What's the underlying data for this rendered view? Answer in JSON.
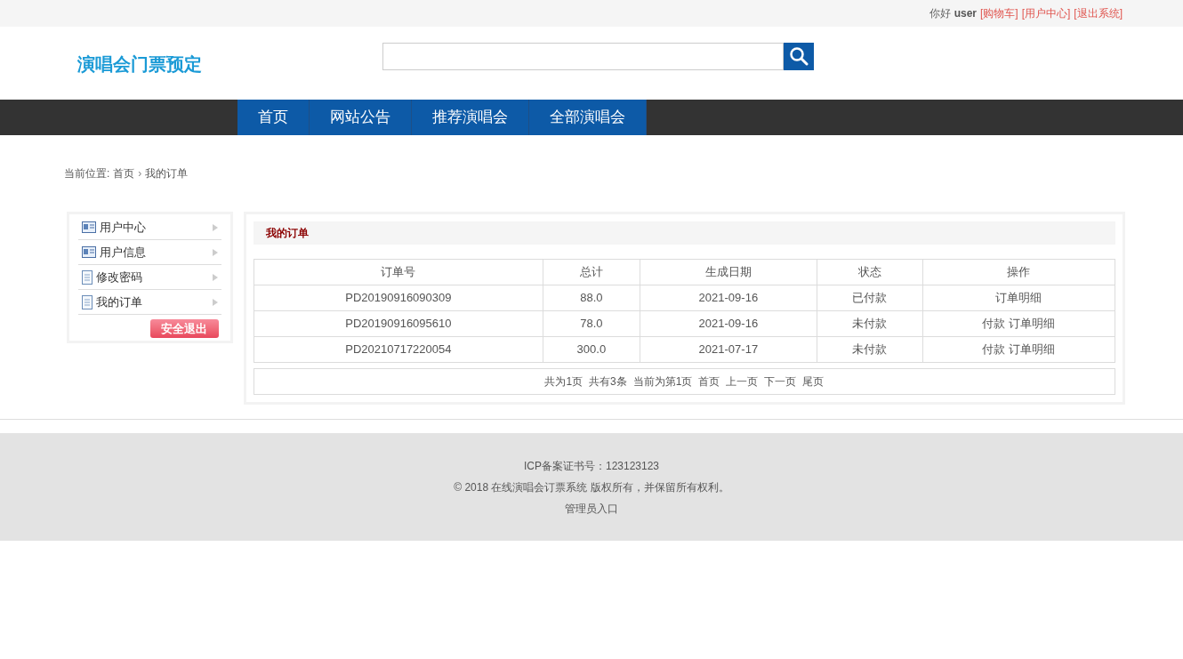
{
  "top_bar": {
    "greeting": "你好",
    "username": "user",
    "links": [
      "[购物车]",
      "[用户中心]",
      "[退出系统]"
    ]
  },
  "logo": "演唱会门票预定",
  "nav": [
    "首页",
    "网站公告",
    "推荐演唱会",
    "全部演唱会"
  ],
  "breadcrumb": {
    "label": "当前位置:",
    "items": [
      "首页",
      "我的订单"
    ],
    "separator": "›"
  },
  "sidebar": {
    "items": [
      {
        "label": "用户中心",
        "kind": "card"
      },
      {
        "label": "用户信息",
        "kind": "card"
      },
      {
        "label": "修改密码",
        "kind": "doc"
      },
      {
        "label": "我的订单",
        "kind": "doc"
      }
    ],
    "logout": "安全退出"
  },
  "orders": {
    "title": "我的订单",
    "columns": [
      "订单号",
      "总计",
      "生成日期",
      "状态",
      "操作"
    ],
    "rows": [
      {
        "id": "PD20190916090309",
        "total": "88.0",
        "date": "2021-09-16",
        "status": "已付款",
        "actions": [
          "订单明细"
        ]
      },
      {
        "id": "PD20190916095610",
        "total": "78.0",
        "date": "2021-09-16",
        "status": "未付款",
        "actions": [
          "付款",
          "订单明细"
        ]
      },
      {
        "id": "PD20210717220054",
        "total": "300.0",
        "date": "2021-07-17",
        "status": "未付款",
        "actions": [
          "付款",
          "订单明细"
        ]
      }
    ],
    "pagination": {
      "info": [
        "共为1页",
        "共有3条",
        "当前为第1页"
      ],
      "links": [
        "首页",
        "上一页",
        "下一页",
        "尾页"
      ]
    }
  },
  "footer": [
    "ICP备案证书号：123123123",
    "© 2018 在线演唱会订票系统 版权所有，并保留所有权利。",
    "管理员入口"
  ]
}
